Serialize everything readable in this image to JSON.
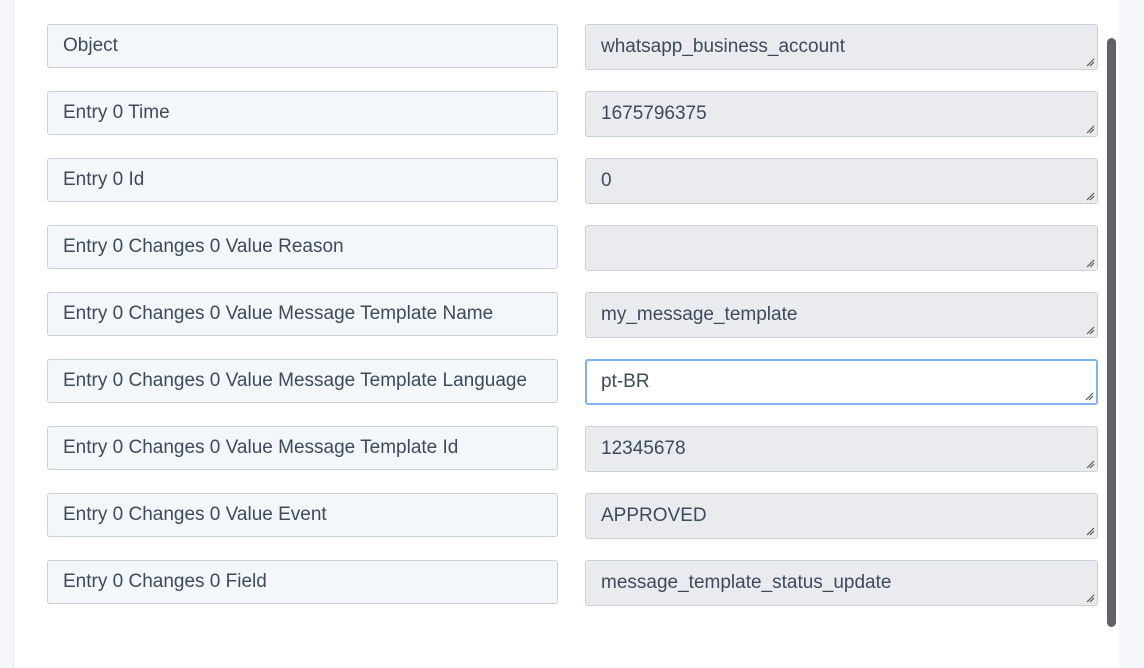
{
  "fields": [
    {
      "label": "Object",
      "value": "whatsapp_business_account"
    },
    {
      "label": "Entry 0 Time",
      "value": "1675796375"
    },
    {
      "label": "Entry 0 Id",
      "value": "0"
    },
    {
      "label": "Entry 0 Changes 0 Value Reason",
      "value": ""
    },
    {
      "label": "Entry 0 Changes 0 Value Message Template Name",
      "value": "my_message_template"
    },
    {
      "label": "Entry 0 Changes 0 Value Message Template Language",
      "value": "pt-BR"
    },
    {
      "label": "Entry 0 Changes 0 Value Message Template Id",
      "value": "12345678"
    },
    {
      "label": "Entry 0 Changes 0 Value Event",
      "value": "APPROVED"
    },
    {
      "label": "Entry 0 Changes 0 Field",
      "value": "message_template_status_update"
    }
  ],
  "focused_index": 5
}
